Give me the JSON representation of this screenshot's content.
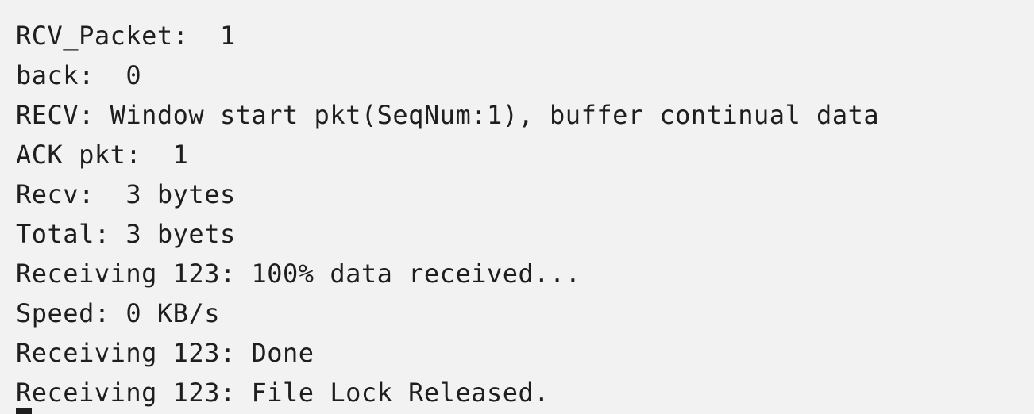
{
  "console": {
    "lines": [
      "RCV_Packet:  1",
      "back:  0",
      "RECV: Window start pkt(SeqNum:1), buffer continual data",
      "ACK pkt:  1",
      "Recv:  3 bytes",
      "Total: 3 byets",
      "Receiving 123: 100% data received...",
      "Speed: 0 KB/s",
      "Receiving 123: Done",
      "Receiving 123: File Lock Released."
    ]
  },
  "colors": {
    "background": "#f2f2f2",
    "text": "#1e1e1e"
  }
}
